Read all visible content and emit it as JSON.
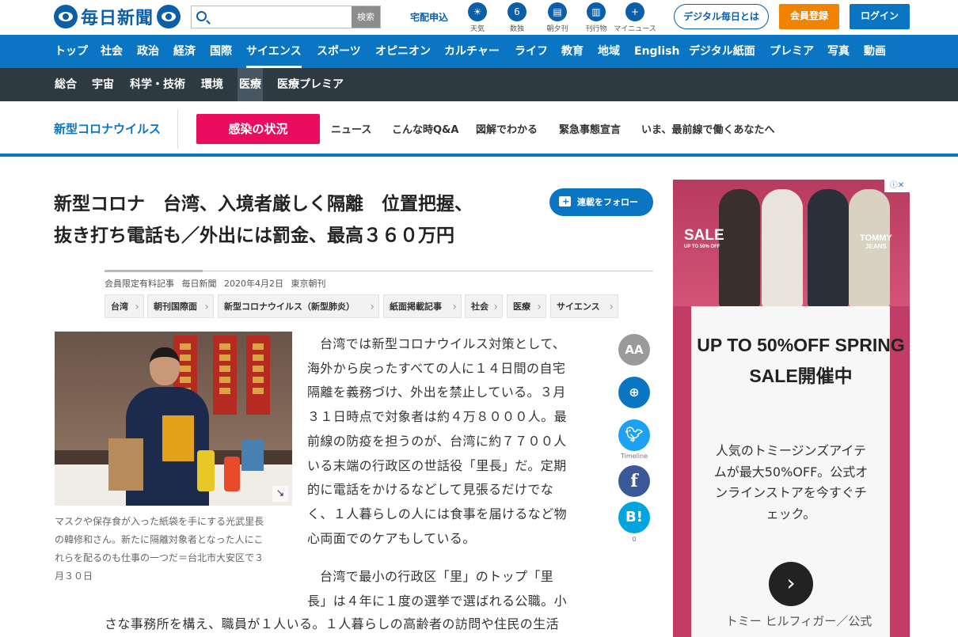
{
  "header": {
    "logo_text": "毎日新聞",
    "search_placeholder": "",
    "search_button": "検索",
    "takuhai": "宅配申込",
    "icons": [
      {
        "name": "weather-icon",
        "glyph": "☀",
        "label": "天気"
      },
      {
        "name": "stats-icon",
        "glyph": "6",
        "label": "数独"
      },
      {
        "name": "newspaper-icon",
        "glyph": "▤",
        "label": "朝夕刊"
      },
      {
        "name": "book-icon",
        "glyph": "▥",
        "label": "刊行物"
      },
      {
        "name": "mynews-icon",
        "glyph": "+",
        "label": "マイニュース"
      }
    ],
    "digital_about": "デジタル毎日とは",
    "register": "会員登録",
    "login": "ログイン"
  },
  "nav_main": [
    "トップ",
    "社会",
    "政治",
    "経済",
    "国際",
    "サイエンス",
    "スポーツ",
    "オピニオン",
    "カルチャー",
    "ライフ",
    "教育",
    "地域",
    "English",
    "デジタル紙面",
    "プレミア",
    "写真",
    "動画"
  ],
  "nav_main_active": "サイエンス",
  "nav_sub": [
    "総合",
    "宇宙",
    "科学・技術",
    "環境",
    "医療",
    "医療プレミア"
  ],
  "nav_sub_active": "医療",
  "covid_bar": {
    "title": "新型コロナウイルス",
    "highlight": "感染の状況",
    "links": [
      "ニュース",
      "こんな時Q&A",
      "図解でわかる",
      "緊急事態宣言",
      "いま、最前線で働くあなたへ"
    ]
  },
  "article": {
    "headline_line1": "新型コロナ　台湾、入境者厳しく隔離　位置把握、",
    "headline_line2": "抜き打ち電話も／外出には罰金、最高３６０万円",
    "follow_label": "連載をフォロー",
    "meta": [
      "会員限定有料記事",
      "毎日新聞",
      "2020年4月2日",
      "東京朝刊"
    ],
    "tags": [
      "台湾",
      "朝刊国際面",
      "新型コロナウイルス（新型肺炎）",
      "紙面掲載記事",
      "社会",
      "医療",
      "サイエンス"
    ],
    "caption": "マスクや保存食が入った紙袋を手にする光武里長の韓修和さん。新たに隔離対象者となった人にこれらを配るのも仕事の一つだ＝台北市大安区で３月３０日",
    "para1_lines": [
      "台湾では新型コロナウイルス対策として、",
      "海外から戻ったすべての人に１４日間の自宅",
      "隔離を義務づけ、外出を禁止している。３月",
      "３１日時点で対象者は約４万８０００人。最",
      "前線の防疫を担うのが、台湾に約７７００人",
      "いる末端の行政区の世話役「里長」だ。定期",
      "的に電話をかけるなどして見張るだけでな",
      "く、１人暮らしの人には食事を届けるなど物",
      "心両面でのケアもしている。"
    ],
    "para2_lines": [
      "台湾で最小の行政区「里」のトップ「里",
      "長」は４年に１度の選挙で選ばれる公職。小"
    ],
    "para3_line": "さな事務所を構え、職員が１人いる。１人暮らしの高齢者の訪問や住民の生活"
  },
  "share": {
    "font_size": "AA",
    "twitter_label": "Timeline",
    "hatena_count": "0"
  },
  "ad": {
    "sale_text": "SALE",
    "sale_sub": "UP TO 50% OFF",
    "brand": "TOMMY",
    "brand_sub": "JEANS",
    "info_label": "ⓘ✕",
    "headline": "UP TO 50%OFF SPRING SALE開催中",
    "description": "人気のトミージンズアイテムが最大50%OFF。公式オンラインストアを今すぐチェック。",
    "advertiser": "トミー ヒルフィガー／公式",
    "colors": {
      "background": "#c13d66",
      "card": "#f7f7f7"
    }
  },
  "colors": {
    "brand_blue": "#0a75c2",
    "dark_nav": "#2d3a42",
    "covid_red": "#ea0c5f",
    "register_orange": "#f08300"
  }
}
